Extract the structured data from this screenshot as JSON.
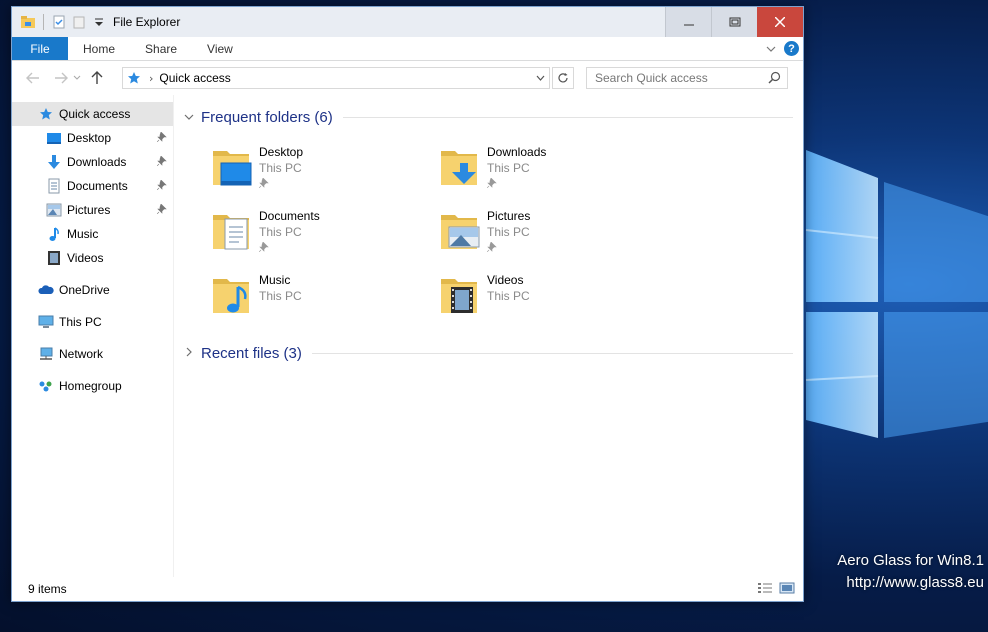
{
  "window": {
    "title": "File Explorer"
  },
  "ribbon": {
    "tabs": [
      "File",
      "Home",
      "Share",
      "View"
    ]
  },
  "address": {
    "location": "Quick access"
  },
  "search": {
    "placeholder": "Search Quick access"
  },
  "sidebar": {
    "items": [
      {
        "label": "Quick access",
        "icon": "star-icon",
        "selected": true,
        "pinned": false
      },
      {
        "label": "Desktop",
        "icon": "desktop-icon",
        "pinned": true
      },
      {
        "label": "Downloads",
        "icon": "download-arrow-icon",
        "pinned": true
      },
      {
        "label": "Documents",
        "icon": "document-icon",
        "pinned": true
      },
      {
        "label": "Pictures",
        "icon": "picture-icon",
        "pinned": true
      },
      {
        "label": "Music",
        "icon": "music-note-icon",
        "pinned": false
      },
      {
        "label": "Videos",
        "icon": "film-icon",
        "pinned": false
      },
      {
        "label": "OneDrive",
        "icon": "cloud-icon",
        "pinned": false
      },
      {
        "label": "This PC",
        "icon": "computer-icon",
        "pinned": false
      },
      {
        "label": "Network",
        "icon": "network-icon",
        "pinned": false
      },
      {
        "label": "Homegroup",
        "icon": "homegroup-icon",
        "pinned": false
      }
    ]
  },
  "content": {
    "frequent_header": "Frequent folders (6)",
    "recent_header": "Recent files (3)",
    "folders": [
      {
        "name": "Desktop",
        "location": "This PC",
        "pinned": true
      },
      {
        "name": "Downloads",
        "location": "This PC",
        "pinned": true
      },
      {
        "name": "Documents",
        "location": "This PC",
        "pinned": true
      },
      {
        "name": "Pictures",
        "location": "This PC",
        "pinned": true
      },
      {
        "name": "Music",
        "location": "This PC",
        "pinned": false
      },
      {
        "name": "Videos",
        "location": "This PC",
        "pinned": false
      }
    ]
  },
  "status": {
    "item_count": "9 items"
  },
  "desktop": {
    "line1": "Aero Glass for Win8.1",
    "line2": "http://www.glass8.eu"
  },
  "colors": {
    "accent": "#1979ca",
    "group_title": "#1e3287",
    "close_button": "#c9473d"
  }
}
